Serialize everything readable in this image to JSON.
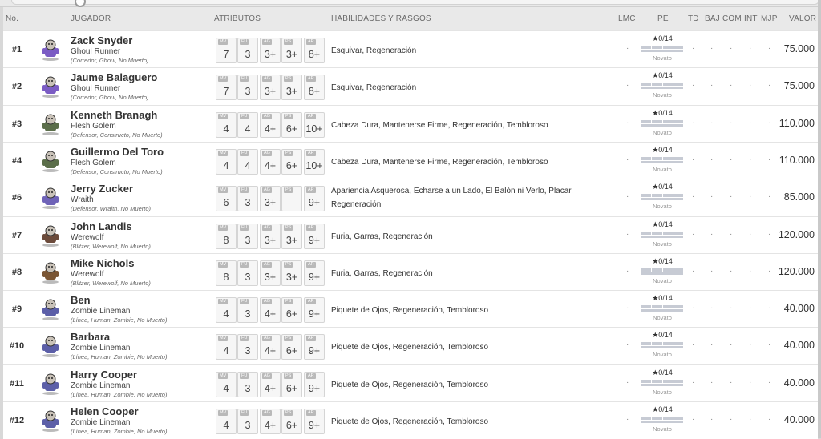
{
  "headers": {
    "no": "No.",
    "player": "JUGADOR",
    "attributes": "ATRIBUTOS",
    "skills": "HABILIDADES Y RASGOS",
    "lmc": "LMC",
    "pe": "PE",
    "td": "TD",
    "baj": "BAJ",
    "com": "COM",
    "int": "INT",
    "mjp": "MJP",
    "value": "VALOR"
  },
  "attr_labels": [
    "MV",
    "FU",
    "AG",
    "PS",
    "AR"
  ],
  "stat_dot": "·",
  "players": [
    {
      "num": "#1",
      "name": "Zack Snyder",
      "position": "Ghoul Runner",
      "tags": "(Corredor, Ghoul, No Muerto)",
      "attrs": [
        "7",
        "3",
        "3+",
        "3+",
        "8+"
      ],
      "skills": "Esquivar, Regeneración",
      "pe": "★0/14",
      "level": "Novato",
      "value": "75.000",
      "avatar_color": "#7b5cc4"
    },
    {
      "num": "#2",
      "name": "Jaume Balaguero",
      "position": "Ghoul Runner",
      "tags": "(Corredor, Ghoul, No Muerto)",
      "attrs": [
        "7",
        "3",
        "3+",
        "3+",
        "8+"
      ],
      "skills": "Esquivar, Regeneración",
      "pe": "★0/14",
      "level": "Novato",
      "value": "75.000",
      "avatar_color": "#7b5cc4"
    },
    {
      "num": "#3",
      "name": "Kenneth Branagh",
      "position": "Flesh Golem",
      "tags": "(Defensor, Constructo, No Muerto)",
      "attrs": [
        "4",
        "4",
        "4+",
        "6+",
        "10+"
      ],
      "skills": "Cabeza Dura, Mantenerse Firme, Regeneración, Tembloroso",
      "pe": "★0/14",
      "level": "Novato",
      "value": "110.000",
      "avatar_color": "#5b6e4a"
    },
    {
      "num": "#4",
      "name": "Guillermo Del Toro",
      "position": "Flesh Golem",
      "tags": "(Defensor, Constructo, No Muerto)",
      "attrs": [
        "4",
        "4",
        "4+",
        "6+",
        "10+"
      ],
      "skills": "Cabeza Dura, Mantenerse Firme, Regeneración, Tembloroso",
      "pe": "★0/14",
      "level": "Novato",
      "value": "110.000",
      "avatar_color": "#5b6e4a"
    },
    {
      "num": "#6",
      "name": "Jerry Zucker",
      "position": "Wraith",
      "tags": "(Defensor, Wraith, No Muerto)",
      "attrs": [
        "6",
        "3",
        "3+",
        "-",
        "9+"
      ],
      "skills": "Apariencia Asquerosa, Echarse a un Lado, El Balón ni Verlo, Placar, Regeneración",
      "pe": "★0/14",
      "level": "Novato",
      "value": "85.000",
      "avatar_color": "#6f63b8"
    },
    {
      "num": "#7",
      "name": "John Landis",
      "position": "Werewolf",
      "tags": "(Blitzer, Werewolf, No Muerto)",
      "attrs": [
        "8",
        "3",
        "3+",
        "3+",
        "9+"
      ],
      "skills": "Furia, Garras, Regeneración",
      "pe": "★0/14",
      "level": "Novato",
      "value": "120.000",
      "avatar_color": "#6b4a3a"
    },
    {
      "num": "#8",
      "name": "Mike Nichols",
      "position": "Werewolf",
      "tags": "(Blitzer, Werewolf, No Muerto)",
      "attrs": [
        "8",
        "3",
        "3+",
        "3+",
        "9+"
      ],
      "skills": "Furia, Garras, Regeneración",
      "pe": "★0/14",
      "level": "Novato",
      "value": "120.000",
      "avatar_color": "#7a5533"
    },
    {
      "num": "#9",
      "name": "Ben",
      "position": "Zombie Lineman",
      "tags": "(Línea, Human, Zombie, No Muerto)",
      "attrs": [
        "4",
        "3",
        "4+",
        "6+",
        "9+"
      ],
      "skills": "Piquete de Ojos, Regeneración, Tembloroso",
      "pe": "★0/14",
      "level": "Novato",
      "value": "40.000",
      "avatar_color": "#5c5fa8"
    },
    {
      "num": "#10",
      "name": "Barbara",
      "position": "Zombie Lineman",
      "tags": "(Línea, Human, Zombie, No Muerto)",
      "attrs": [
        "4",
        "3",
        "4+",
        "6+",
        "9+"
      ],
      "skills": "Piquete de Ojos, Regeneración, Tembloroso",
      "pe": "★0/14",
      "level": "Novato",
      "value": "40.000",
      "avatar_color": "#5c5fa8"
    },
    {
      "num": "#11",
      "name": "Harry Cooper",
      "position": "Zombie Lineman",
      "tags": "(Línea, Human, Zombie, No Muerto)",
      "attrs": [
        "4",
        "3",
        "4+",
        "6+",
        "9+"
      ],
      "skills": "Piquete de Ojos, Regeneración, Tembloroso",
      "pe": "★0/14",
      "level": "Novato",
      "value": "40.000",
      "avatar_color": "#5c5fa8"
    },
    {
      "num": "#12",
      "name": "Helen Cooper",
      "position": "Zombie Lineman",
      "tags": "(Línea, Human, Zombie, No Muerto)",
      "attrs": [
        "4",
        "3",
        "4+",
        "6+",
        "9+"
      ],
      "skills": "Piquete de Ojos, Regeneración, Tembloroso",
      "pe": "★0/14",
      "level": "Novato",
      "value": "40.000",
      "avatar_color": "#5c5fa8"
    }
  ]
}
